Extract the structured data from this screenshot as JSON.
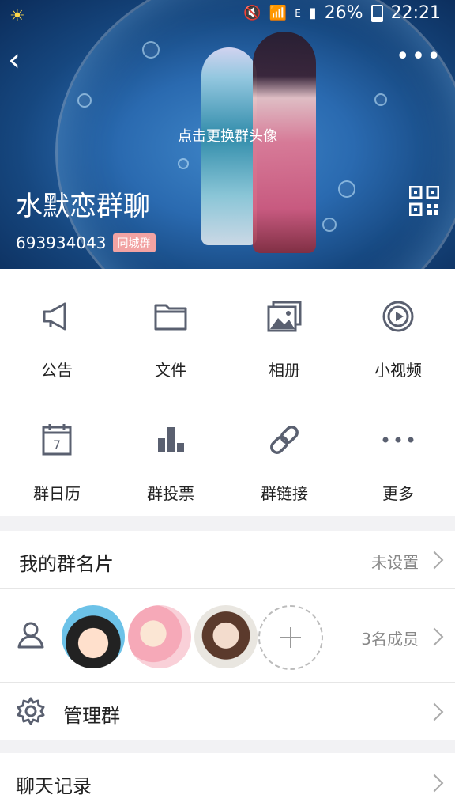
{
  "status_bar": {
    "battery": "26%",
    "time": "22:21",
    "network": "E"
  },
  "header": {
    "change_avatar_hint": "点击更换群头像",
    "group_name": "水默恋群聊",
    "group_id": "693934043",
    "city_tag": "同城群",
    "colors": {
      "tag_bg": "#f2a3a3"
    }
  },
  "grid": {
    "items": [
      {
        "label": "公告",
        "icon": "megaphone-icon"
      },
      {
        "label": "文件",
        "icon": "folder-icon"
      },
      {
        "label": "相册",
        "icon": "photo-album-icon"
      },
      {
        "label": "小视频",
        "icon": "video-play-icon"
      },
      {
        "label": "群日历",
        "icon": "calendar-icon",
        "date": "7"
      },
      {
        "label": "群投票",
        "icon": "bar-chart-icon"
      },
      {
        "label": "群链接",
        "icon": "link-icon"
      },
      {
        "label": "更多",
        "icon": "more-dots-icon"
      }
    ]
  },
  "group_card": {
    "title": "我的群名片",
    "value": "未设置"
  },
  "members": {
    "count_label": "3名成员"
  },
  "manage": {
    "title": "管理群"
  },
  "chat_history": {
    "title": "聊天记录"
  }
}
